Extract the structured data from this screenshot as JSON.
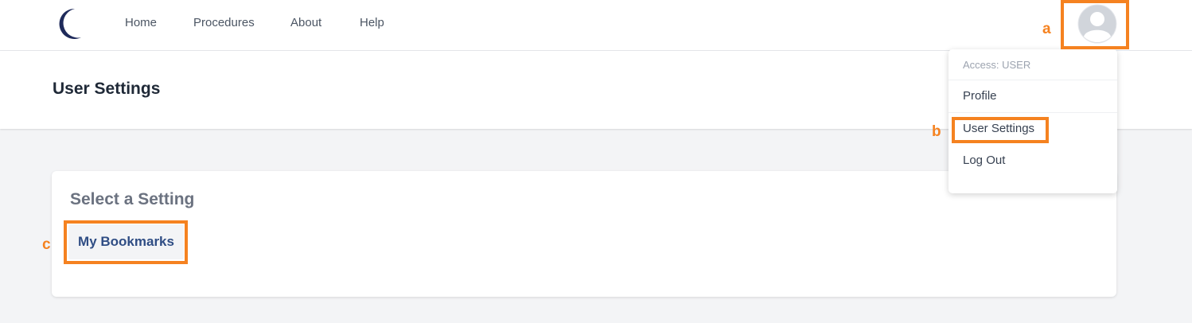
{
  "nav": {
    "logo_icon": "crescent-logo-icon",
    "links": [
      "Home",
      "Procedures",
      "About",
      "Help"
    ],
    "avatar_icon": "user-avatar-icon"
  },
  "header": {
    "title": "User Settings"
  },
  "card": {
    "title": "Select a Setting",
    "bookmarks_label": "My Bookmarks"
  },
  "dropdown": {
    "access": "Access: USER",
    "items": [
      "Profile",
      "User Settings",
      "Log Out"
    ]
  },
  "annotations": {
    "a": "a",
    "b": "b",
    "c": "c"
  },
  "colors": {
    "highlight": "#f58220",
    "button_text": "#2f4d84",
    "background": "#f3f4f6"
  }
}
